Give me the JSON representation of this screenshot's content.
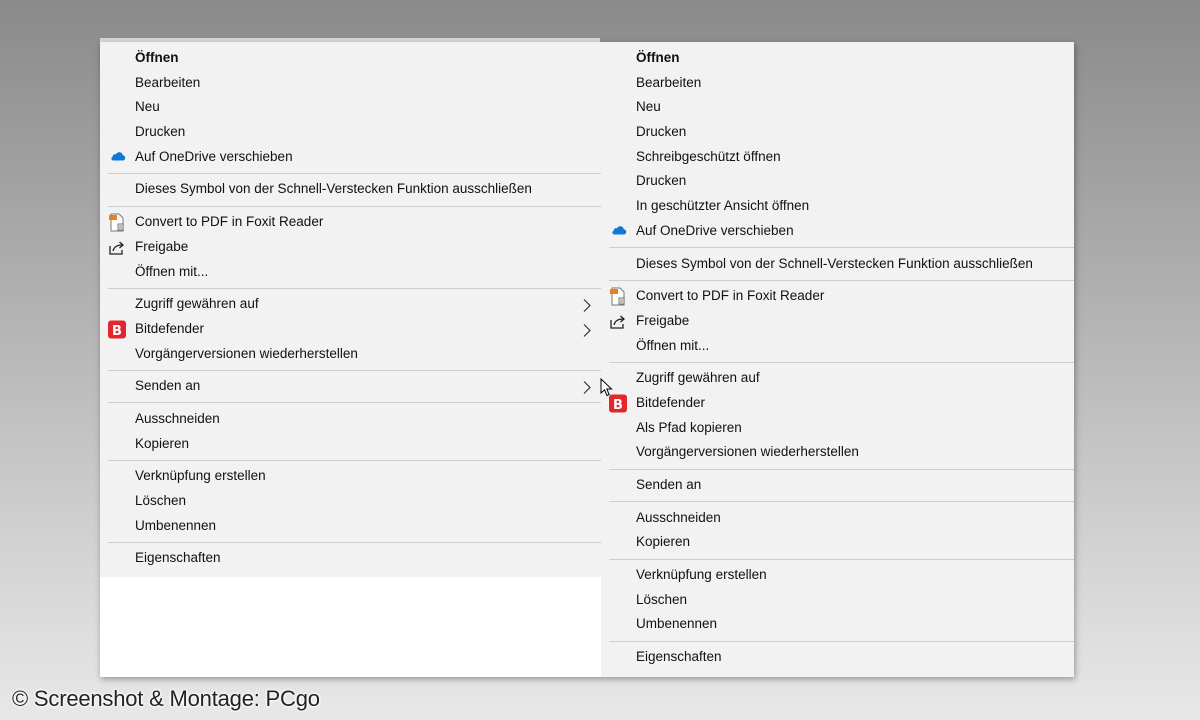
{
  "left_menu": {
    "items": [
      {
        "type": "item",
        "label": "Öffnen",
        "bold": true
      },
      {
        "type": "item",
        "label": "Bearbeiten"
      },
      {
        "type": "item",
        "label": "Neu"
      },
      {
        "type": "item",
        "label": "Drucken"
      },
      {
        "type": "item",
        "label": "Auf OneDrive verschieben",
        "icon": "onedrive-icon"
      },
      {
        "type": "separator"
      },
      {
        "type": "item",
        "label": "Dieses Symbol von der Schnell-Verstecken Funktion ausschließen"
      },
      {
        "type": "separator"
      },
      {
        "type": "item",
        "label": "Convert to PDF in Foxit Reader",
        "icon": "foxit-pdf-icon"
      },
      {
        "type": "item",
        "label": "Freigabe",
        "icon": "share-icon"
      },
      {
        "type": "item",
        "label": "Öffnen mit..."
      },
      {
        "type": "separator"
      },
      {
        "type": "item",
        "label": "Zugriff gewähren auf",
        "submenu": true
      },
      {
        "type": "item",
        "label": "Bitdefender",
        "icon": "bitdefender-icon",
        "submenu": true
      },
      {
        "type": "item",
        "label": "Vorgängerversionen wiederherstellen"
      },
      {
        "type": "separator"
      },
      {
        "type": "item",
        "label": "Senden an",
        "submenu": true
      },
      {
        "type": "separator"
      },
      {
        "type": "item",
        "label": "Ausschneiden"
      },
      {
        "type": "item",
        "label": "Kopieren"
      },
      {
        "type": "separator"
      },
      {
        "type": "item",
        "label": "Verknüpfung erstellen"
      },
      {
        "type": "item",
        "label": "Löschen"
      },
      {
        "type": "item",
        "label": "Umbenennen"
      },
      {
        "type": "separator"
      },
      {
        "type": "item",
        "label": "Eigenschaften"
      }
    ]
  },
  "right_menu": {
    "items": [
      {
        "type": "item",
        "label": "Öffnen",
        "bold": true
      },
      {
        "type": "item",
        "label": "Bearbeiten"
      },
      {
        "type": "item",
        "label": "Neu"
      },
      {
        "type": "item",
        "label": "Drucken"
      },
      {
        "type": "item",
        "label": "Schreibgeschützt öffnen"
      },
      {
        "type": "item",
        "label": "Drucken"
      },
      {
        "type": "item",
        "label": "In geschützter Ansicht öffnen"
      },
      {
        "type": "item",
        "label": "Auf OneDrive verschieben",
        "icon": "onedrive-icon"
      },
      {
        "type": "separator"
      },
      {
        "type": "item",
        "label": "Dieses Symbol von der Schnell-Verstecken Funktion ausschließen"
      },
      {
        "type": "separator"
      },
      {
        "type": "item",
        "label": "Convert to PDF in Foxit Reader",
        "icon": "foxit-pdf-icon"
      },
      {
        "type": "item",
        "label": "Freigabe",
        "icon": "share-icon"
      },
      {
        "type": "item",
        "label": "Öffnen mit..."
      },
      {
        "type": "separator"
      },
      {
        "type": "item",
        "label": "Zugriff gewähren auf"
      },
      {
        "type": "item",
        "label": "Bitdefender",
        "icon": "bitdefender-icon"
      },
      {
        "type": "item",
        "label": "Als Pfad kopieren"
      },
      {
        "type": "item",
        "label": "Vorgängerversionen wiederherstellen"
      },
      {
        "type": "separator"
      },
      {
        "type": "item",
        "label": "Senden an"
      },
      {
        "type": "separator"
      },
      {
        "type": "item",
        "label": "Ausschneiden"
      },
      {
        "type": "item",
        "label": "Kopieren"
      },
      {
        "type": "separator"
      },
      {
        "type": "item",
        "label": "Verknüpfung erstellen"
      },
      {
        "type": "item",
        "label": "Löschen"
      },
      {
        "type": "item",
        "label": "Umbenennen"
      },
      {
        "type": "separator"
      },
      {
        "type": "item",
        "label": "Eigenschaften"
      }
    ]
  },
  "watermark": "© Screenshot & Montage: PCgo",
  "colors": {
    "menu_background": "#f2f2f2",
    "separator": "#cdcdcd",
    "onedrive_blue": "#0f78d4",
    "bitdefender_red": "#e3262b",
    "foxit_orange": "#f07f1b"
  }
}
